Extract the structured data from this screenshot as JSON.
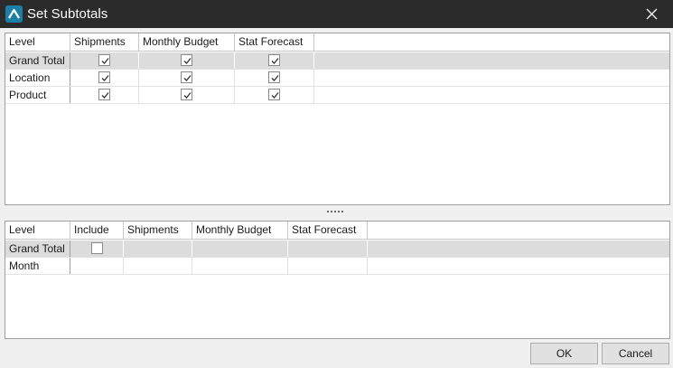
{
  "window": {
    "title": "Set Subtotals",
    "icon": "app-logo-icon",
    "close_icon": "close-icon"
  },
  "top_grid": {
    "columns": [
      "Level",
      "Shipments",
      "Monthly Budget",
      "Stat Forecast"
    ],
    "rows": [
      {
        "level": "Grand Total",
        "checks": [
          true,
          true,
          true
        ],
        "selected": true
      },
      {
        "level": "Location",
        "checks": [
          true,
          true,
          true
        ],
        "selected": false
      },
      {
        "level": "Product",
        "checks": [
          true,
          true,
          true
        ],
        "selected": false
      }
    ]
  },
  "bottom_grid": {
    "columns": [
      "Level",
      "Include",
      "Shipments",
      "Monthly Budget",
      "Stat Forecast"
    ],
    "rows": [
      {
        "level": "Grand Total",
        "include": false,
        "selected": true
      },
      {
        "level": "Month",
        "include": null,
        "selected": false
      }
    ]
  },
  "buttons": {
    "ok_label": "OK",
    "cancel_label": "Cancel"
  },
  "colors": {
    "titlebar": "#2b2b2b",
    "accent": "#1e7fa6",
    "selected_row": "#dcdcdc"
  }
}
